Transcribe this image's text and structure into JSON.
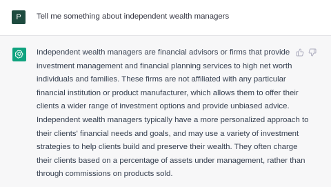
{
  "user_message": {
    "avatar_letter": "P",
    "text": "Tell me something about independent wealth managers"
  },
  "assistant_message": {
    "lines": [
      "Independent wealth managers are financial advisors or firms that provide",
      "investment management and financial planning services to high net worth",
      "individuals and families. These firms are not affiliated with any particular",
      "financial institution or product manufacturer, which allows them to offer their",
      "clients a wider range of investment options and provide unbiased advice.",
      "Independent wealth managers typically have a more personalized approach to",
      "their clients' financial needs and goals, and may use a variety of investment",
      "strategies to help clients build and preserve their wealth. They often charge",
      "their clients based on a percentage of assets under management, rather than",
      "through commissions on products sold."
    ]
  },
  "icons": {
    "assistant_avatar": "openai-logo-icon",
    "like": "thumbs-up-icon",
    "dislike": "thumbs-down-icon"
  },
  "colors": {
    "user_avatar_bg": "#1e4b3f",
    "assistant_avatar_bg": "#10a37f",
    "assistant_row_bg": "#f7f7f8",
    "text": "#374151"
  }
}
